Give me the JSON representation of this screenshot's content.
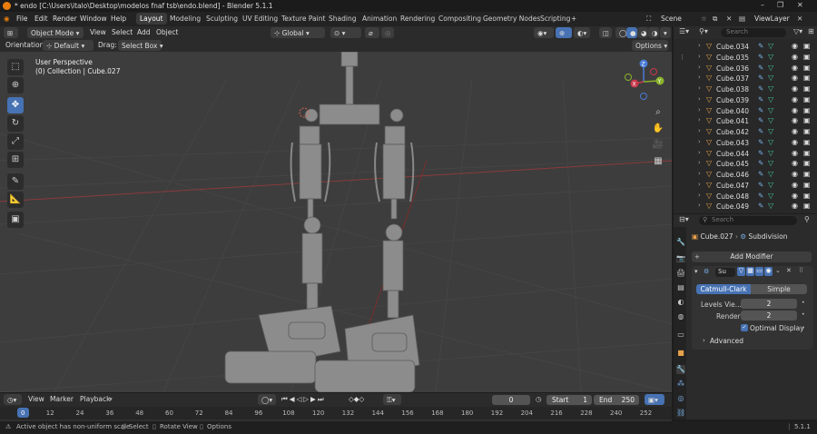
{
  "titlebar": {
    "title": "* endo [C:\\Users\\italo\\Desktop\\modelos fnaf tsb\\endo.blend] - Blender 5.1.1"
  },
  "menus": [
    "File",
    "Edit",
    "Render",
    "Window",
    "Help"
  ],
  "workspaces": [
    "Layout",
    "Modeling",
    "Sculpting",
    "UV Editing",
    "Texture Paint",
    "Shading",
    "Animation",
    "Rendering",
    "Compositing",
    "Geometry Nodes",
    "Scripting"
  ],
  "scene": "Scene",
  "viewlayer": "ViewLayer",
  "viewport_header": {
    "mode": "Object Mode",
    "menus": [
      "View",
      "Select",
      "Add",
      "Object"
    ],
    "transform": "Global",
    "orientation_label": "Orientation:",
    "orientation_value": "Default",
    "drag_label": "Drag:",
    "drag_value": "Select Box",
    "options": "Options"
  },
  "viewport": {
    "perspective": "User Perspective",
    "collection_info": "(0) Collection | Cube.027"
  },
  "gizmo": {
    "x": "X",
    "y": "Y",
    "z": "Z"
  },
  "outliner": {
    "search_placeholder": "Search",
    "items": [
      "Cube.034",
      "Cube.035",
      "Cube.036",
      "Cube.037",
      "Cube.038",
      "Cube.039",
      "Cube.040",
      "Cube.041",
      "Cube.042",
      "Cube.043",
      "Cube.044",
      "Cube.045",
      "Cube.046",
      "Cube.047",
      "Cube.048",
      "Cube.049"
    ]
  },
  "properties": {
    "search_placeholder": "Search",
    "object": "Cube.027",
    "modifier_path": "Subdivision",
    "add_modifier": "Add Modifier",
    "modifier_name": "Su",
    "catmull": "Catmull-Clark",
    "simple": "Simple",
    "levels_label": "Levels Vie...",
    "levels_value": "2",
    "render_label": "Render",
    "render_value": "2",
    "optimal_display": "Optimal Display",
    "advanced": "Advanced"
  },
  "timeline": {
    "menus": [
      "View",
      "Marker",
      "Playback"
    ],
    "current_frame": "0",
    "start_label": "Start",
    "start_value": "1",
    "end_label": "End",
    "end_value": "250",
    "ruler": [
      "0",
      "12",
      "24",
      "36",
      "48",
      "60",
      "72",
      "84",
      "96",
      "108",
      "120",
      "132",
      "144",
      "156",
      "168",
      "180",
      "192",
      "204",
      "216",
      "228",
      "240",
      "252"
    ]
  },
  "status": {
    "message": "Active object has non-uniform scale",
    "select": "Select",
    "rotate": "Rotate View",
    "options": "Options",
    "version": "5.1.1"
  },
  "colors": {
    "accent": "#4772b3",
    "background": "#3d3d3d",
    "header": "#2b2b2b",
    "object_orange": "#e8a24a",
    "mesh_green": "#43c59e"
  }
}
